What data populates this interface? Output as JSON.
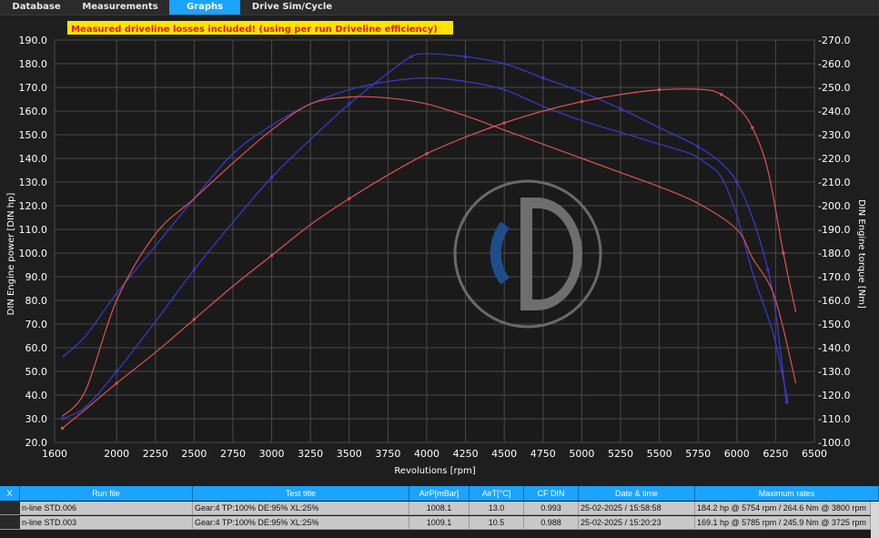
{
  "tabs": [
    {
      "label": "Database",
      "active": false
    },
    {
      "label": "Measurements",
      "active": false
    },
    {
      "label": "Graphs",
      "active": true
    },
    {
      "label": "Drive Sim/Cycle",
      "active": false
    }
  ],
  "banner": "Measured driveline losses included! (using per run Driveline efficiency)",
  "chart_data": {
    "type": "line",
    "xlabel": "Revolutions [rpm]",
    "ylabel": "DIN Engine power [DIN hp]",
    "y2label": "DIN Engine torque [Nm]",
    "xlim": [
      1600,
      6500
    ],
    "ylim": [
      20,
      190
    ],
    "y2lim": [
      100,
      270
    ],
    "xticks": [
      1600,
      2000,
      2250,
      2500,
      2750,
      3000,
      3250,
      3500,
      3750,
      4000,
      4250,
      4500,
      4750,
      5000,
      5250,
      5500,
      5750,
      6000,
      6250,
      6500
    ],
    "xtick_labels": [
      "1600",
      "2000",
      "2250",
      "2500",
      "2750",
      "3000",
      "3250",
      "3500",
      "3750",
      "4000",
      "4250",
      "4500",
      "4750",
      "5000",
      "5250",
      "5500",
      "5750",
      "6000",
      "6250",
      "6500"
    ],
    "yticks": [
      20,
      30,
      40,
      50,
      60,
      70,
      80,
      90,
      100,
      110,
      120,
      130,
      140,
      150,
      160,
      170,
      180,
      190
    ],
    "ytick_labels": [
      "20.0",
      "30.0",
      "40.0",
      "50.0",
      "60.0",
      "70.0",
      "80.0",
      "90.0",
      "100.0",
      "110.0",
      "120.0",
      "130.0",
      "140.0",
      "150.0",
      "160.0",
      "170.0",
      "180.0",
      "190.0"
    ],
    "y2ticks": [
      100,
      110,
      120,
      130,
      140,
      150,
      160,
      170,
      180,
      190,
      200,
      210,
      220,
      230,
      240,
      250,
      260,
      270
    ],
    "y2tick_labels": [
      "-100.0",
      "-110.0",
      "-120.0",
      "-130.0",
      "-140.0",
      "-150.0",
      "-160.0",
      "-170.0",
      "-180.0",
      "-190.0",
      "-200.0",
      "-210.0",
      "-220.0",
      "-230.0",
      "-240.0",
      "-250.0",
      "-260.0",
      "-270.0"
    ],
    "grid": true,
    "series": [
      {
        "color": "#3a3ad8",
        "axis": "left",
        "markers": true,
        "x": [
          1650,
          1800,
          2000,
          2250,
          2500,
          2750,
          3000,
          3250,
          3500,
          3750,
          3900,
          4000,
          4250,
          4500,
          4750,
          5000,
          5250,
          5500,
          5750,
          5900,
          6000,
          6100,
          6200,
          6250,
          6320
        ],
        "y": [
          30,
          35,
          50,
          71,
          93,
          113,
          132,
          148,
          163,
          176,
          183,
          184.2,
          183,
          180,
          174,
          168,
          161,
          153,
          145,
          138,
          130,
          115,
          93,
          75,
          37
        ]
      },
      {
        "color": "#3a3ad8",
        "axis": "right",
        "markers": false,
        "x": [
          1650,
          1800,
          2000,
          2250,
          2500,
          2750,
          3000,
          3250,
          3500,
          3750,
          4000,
          4250,
          4500,
          4750,
          5000,
          5250,
          5500,
          5700,
          5800,
          5900,
          6000,
          6100,
          6200,
          6250,
          6330
        ],
        "y": [
          136,
          145,
          163,
          183,
          203,
          222,
          234,
          243,
          249,
          252.5,
          254,
          252.5,
          249,
          242,
          236,
          231,
          226,
          222,
          218,
          212,
          196,
          172,
          153,
          142,
          117
        ]
      },
      {
        "color": "#e05252",
        "axis": "left",
        "markers": true,
        "x": [
          1650,
          1800,
          2000,
          2250,
          2500,
          2750,
          3000,
          3250,
          3500,
          3750,
          4000,
          4250,
          4500,
          4750,
          5000,
          5250,
          5500,
          5785,
          5900,
          6000,
          6100,
          6200,
          6300,
          6380
        ],
        "y": [
          26,
          34,
          45,
          58,
          72,
          86,
          99,
          112,
          123,
          133,
          142,
          149,
          155,
          160,
          164,
          167,
          169,
          169.1,
          167,
          162,
          153,
          135,
          100,
          75
        ]
      },
      {
        "color": "#e05252",
        "axis": "right",
        "markers": false,
        "x": [
          1650,
          1800,
          2000,
          2250,
          2500,
          2750,
          3000,
          3250,
          3500,
          3750,
          4000,
          4250,
          4500,
          4750,
          5000,
          5250,
          5500,
          5750,
          6000,
          6100,
          6200,
          6250,
          6300,
          6380
        ],
        "y": [
          111,
          122,
          160,
          188,
          203,
          218,
          232,
          243,
          245.9,
          245.5,
          243,
          238,
          232,
          226,
          220,
          214,
          208,
          201,
          190,
          178,
          168,
          160,
          148,
          125
        ]
      }
    ]
  },
  "table": {
    "close_label": "X",
    "columns": [
      "Run file",
      "Test title",
      "AirP[mBar]",
      "AirT[°C]",
      "CF DIN",
      "Date & time",
      "Maximum rates"
    ],
    "rows": [
      [
        "n-line STD.006",
        "Gear:4 TP:100% DE:95% XL:25%",
        "1008.1",
        "13.0",
        "0.993",
        "25-02-2025 / 15:58:58",
        "184.2 hp @ 5754 rpm / 264.6 Nm @ 3800 rpm"
      ],
      [
        "n-line STD.003",
        "Gear:4 TP:100% DE:95% XL:25%",
        "1009.1",
        "10.5",
        "0.988",
        "25-02-2025 / 15:20:23",
        "169.1 hp @ 5785 rpm / 245.9 Nm @ 3725 rpm"
      ]
    ]
  }
}
